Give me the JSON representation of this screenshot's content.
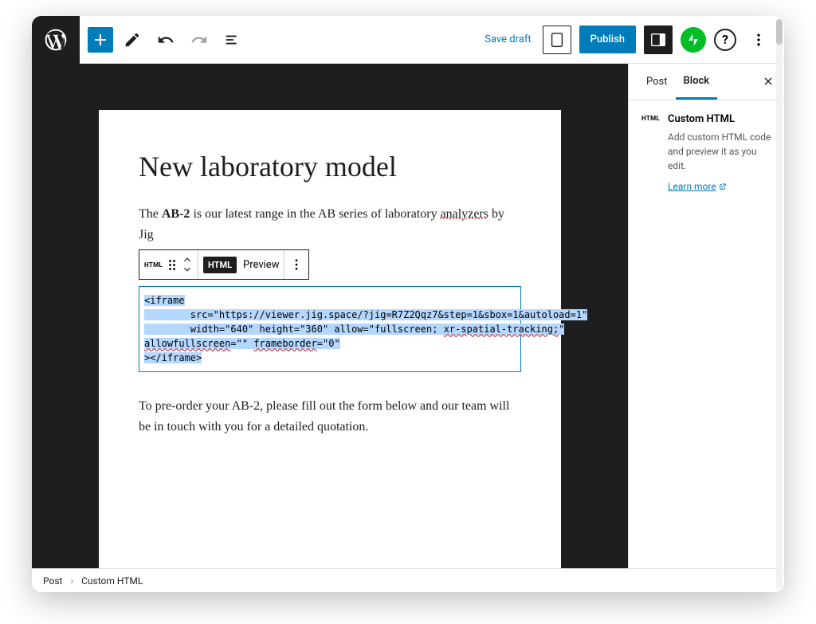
{
  "topbar": {
    "save_draft": "Save draft",
    "publish": "Publish",
    "help": "?"
  },
  "editor": {
    "title": "New laboratory model",
    "para1_pre": "The ",
    "para1_bold": "AB-2",
    "para1_mid": " is our latest range in the AB series of laboratory ",
    "para1_underlined": "analyzers",
    "para1_post": " by Jig",
    "para2": "To pre-order your AB-2, please fill out the form below and our team will be in touch with you for a detailed quotation."
  },
  "block_toolbar": {
    "type_label": "HTML",
    "html_label": "HTML",
    "preview_label": "Preview"
  },
  "code": {
    "l1": "<iframe",
    "l2a": "        src=\"https://viewer.jig.space/?jig=R7Z2Qqz7&step=1&sbox=1&autoload=1\"",
    "l3_pre": "        width=\"640\" height=\"360\" allow=\"fullscreen; ",
    "l3_red": "xr-spatial-tracking;",
    "l3_post": "\"",
    "l4_pre": "allowfullscreen",
    "l4_mid": "=\"\" ",
    "l4_fb": "frameborder",
    "l4_post": "=\"0\"",
    "l5": "></iframe>"
  },
  "sidebar": {
    "tab_post": "Post",
    "tab_block": "Block",
    "block_type_label": "HTML",
    "block_title": "Custom HTML",
    "block_desc": "Add custom HTML code and preview it as you edit.",
    "learn_more": "Learn more"
  },
  "breadcrumb": {
    "root": "Post",
    "current": "Custom HTML"
  }
}
